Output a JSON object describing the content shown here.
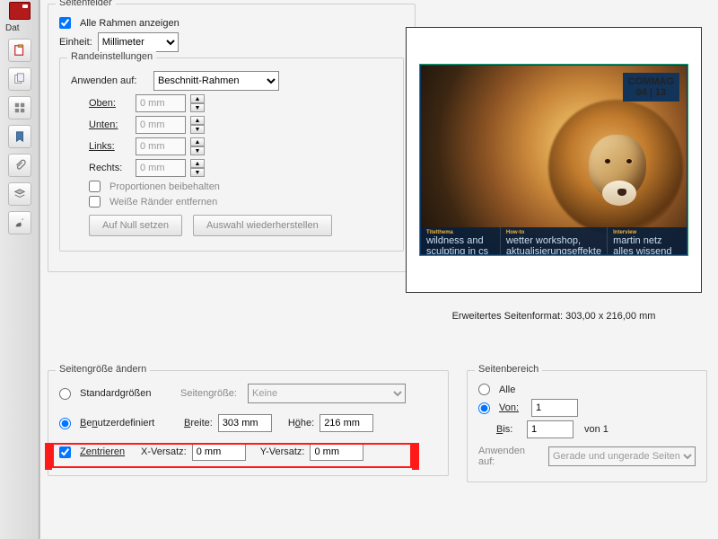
{
  "toolbar": {
    "file_label": "Dat"
  },
  "seitenfelder": {
    "title": "Seitenfelder",
    "show_all_frames": "Alle Rahmen anzeigen",
    "unit_label": "Einheit:",
    "unit_value": "Millimeter",
    "margins": {
      "title": "Randeinstellungen",
      "apply_to_label": "Anwenden auf:",
      "apply_to_value": "Beschnitt-Rahmen",
      "top": "Oben:",
      "bottom": "Unten:",
      "left": "Links:",
      "right": "Rechts:",
      "val": "0 mm",
      "keep_prop": "Proportionen beibehalten",
      "remove_white": "Weiße Ränder entfernen",
      "reset": "Auf Null setzen",
      "restore": "Auswahl wiederherstellen"
    }
  },
  "preview": {
    "logo_top": "COMMAG",
    "logo_sub": "04 | 13",
    "col1_title": "Titelthema",
    "col1_text": "wildness and sculpting in cs",
    "col2_title": "How-to",
    "col2_text": "wetter workshop, aktualisierungseffekte",
    "col3_title": "Interview",
    "col3_text": "martin netz alles wissend",
    "caption": "Erweitertes Seitenformat: 303,00 x 216,00 mm"
  },
  "resize": {
    "title": "Seitengröße ändern",
    "preset": "Standardgrößen",
    "page_size_label": "Seitengröße:",
    "page_size_value": "Keine",
    "custom": "Benutzerdefiniert",
    "width_label": "Breite:",
    "width_val": "303 mm",
    "height_label": "Höhe:",
    "height_val": "216 mm",
    "center": "Zentrieren",
    "x_off": "X-Versatz:",
    "y_off": "Y-Versatz:",
    "off_val": "0 mm"
  },
  "range": {
    "title": "Seitenbereich",
    "all": "Alle",
    "from": "Von:",
    "to": "Bis:",
    "from_val": "1",
    "to_val": "1",
    "of": "von 1",
    "apply_to": "Anwenden auf:",
    "apply_val": "Gerade und ungerade Seiten"
  }
}
